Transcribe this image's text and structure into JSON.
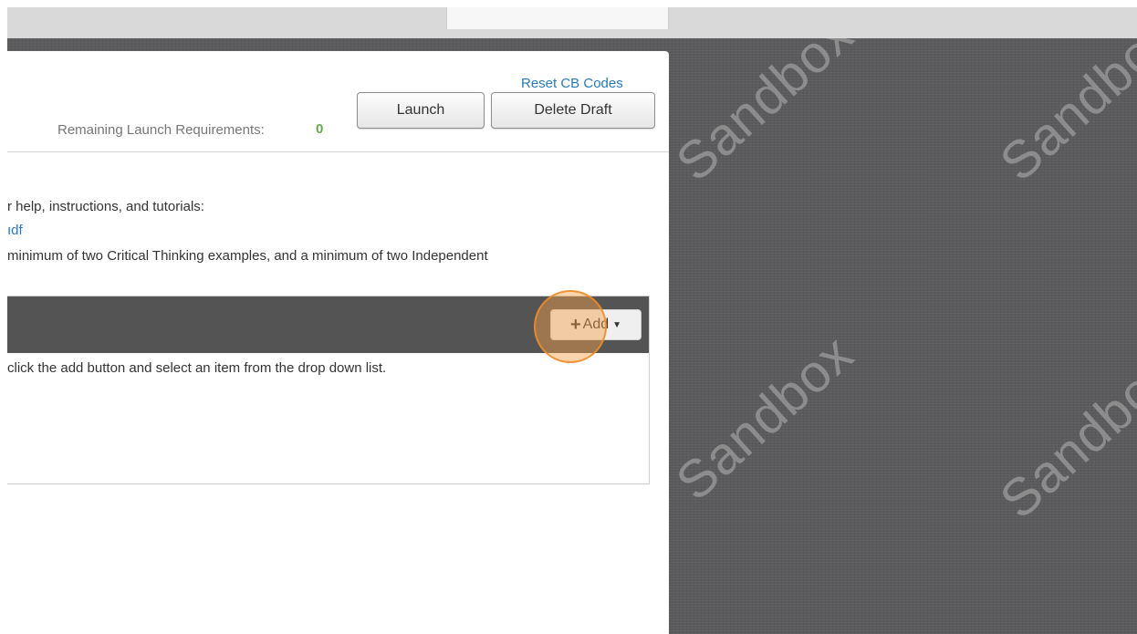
{
  "header": {
    "reset_link": "Reset CB Codes",
    "remaining_label": "Remaining Launch Requirements:",
    "remaining_count": "0",
    "launch_label": "Launch",
    "delete_label": "Delete Draft"
  },
  "content": {
    "help_text": "r help, instructions, and tutorials:",
    "pdf_link": "ıdf",
    "requirement_text": "minimum of two Critical Thinking examples, and a minimum of two Independent"
  },
  "items": {
    "add_label": "Add",
    "instruction_text": "click the add button and select an item from the drop down list."
  },
  "background": {
    "watermark_text": "Sandbox"
  },
  "colors": {
    "link": "#2a7ab8",
    "count": "#6aa84f",
    "items_header": "#545454",
    "highlight": "#f3a046"
  }
}
